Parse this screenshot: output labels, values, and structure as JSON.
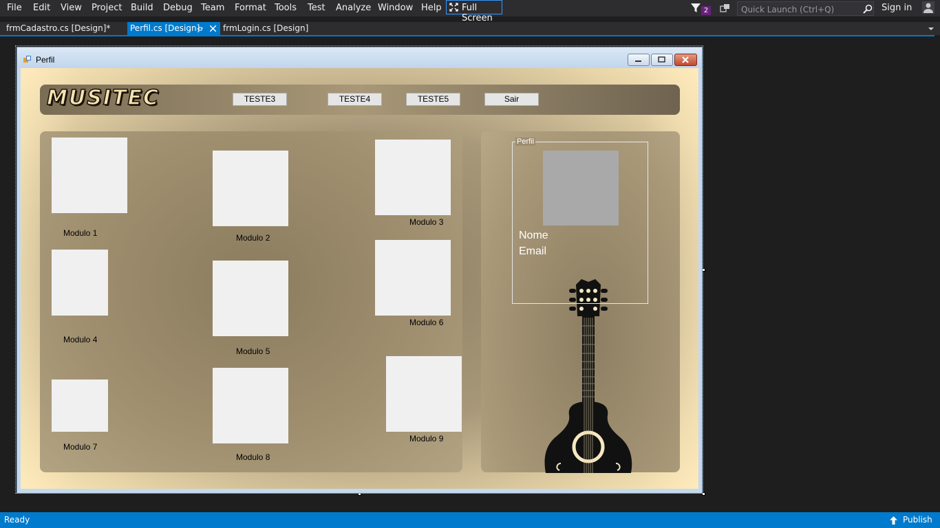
{
  "menubar": {
    "items": [
      "File",
      "Edit",
      "View",
      "Project",
      "Build",
      "Debug",
      "Team",
      "Format",
      "Tools",
      "Test",
      "Analyze",
      "Window",
      "Help"
    ],
    "full_screen": "Full Screen",
    "notification_count": "2",
    "quick_launch_placeholder": "Quick Launch (Ctrl+Q)",
    "sign_in": "Sign in"
  },
  "tabs": [
    {
      "label": "frmCadastro.cs [Design]*",
      "active": false
    },
    {
      "label": "Perfil.cs [Design]",
      "active": true
    },
    {
      "label": "frmLogin.cs [Design]",
      "active": false
    }
  ],
  "form": {
    "title": "Perfil",
    "logo": "MUSITEC",
    "header_buttons": [
      "TESTE3",
      "TESTE4",
      "TESTE5",
      "Sair"
    ],
    "modules": [
      "Modulo 1",
      "Modulo 2",
      "Modulo 3",
      "Modulo 4",
      "Modulo 5",
      "Modulo 6",
      "Modulo 7",
      "Modulo 8",
      "Modulo 9"
    ],
    "profile": {
      "group_title": "Perfil",
      "name_label": "Nome",
      "email_label": "Email"
    }
  },
  "statusbar": {
    "status": "Ready",
    "publish": "Publish"
  },
  "colors": {
    "accent": "#007acc",
    "ide_background": "#1e1e1e",
    "menubar": "#2d2d30"
  }
}
